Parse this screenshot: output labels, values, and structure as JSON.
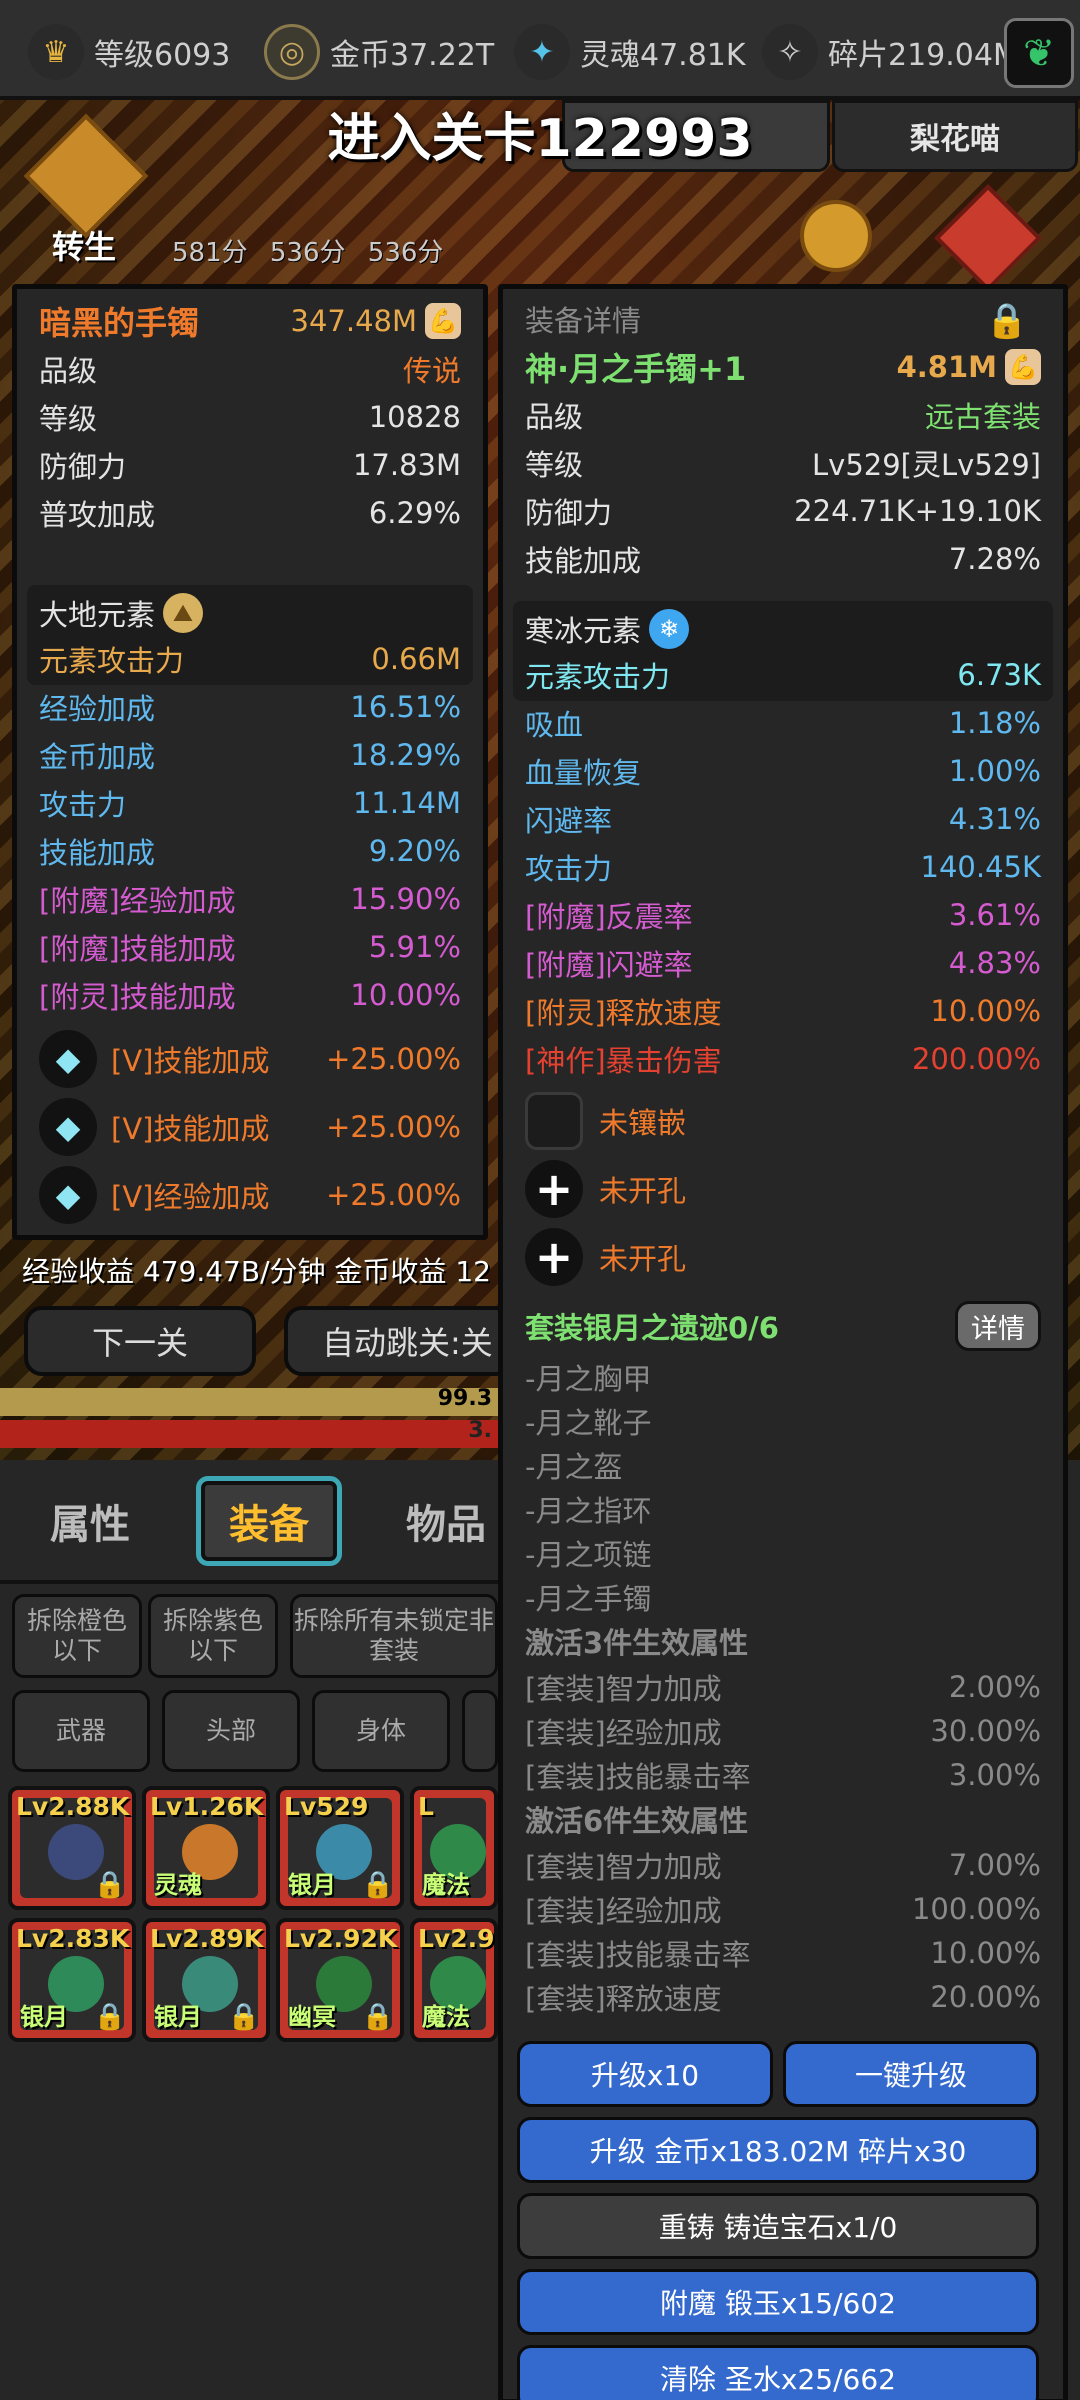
{
  "top_bar": {
    "stats": [
      {
        "icon": "crown-icon",
        "label": "等级6093"
      },
      {
        "icon": "coin-icon",
        "label": "金币37.22T"
      },
      {
        "icon": "soul-icon",
        "label": "灵魂47.81K"
      },
      {
        "icon": "shard-icon",
        "label": "碎片219.04M"
      }
    ]
  },
  "banner": "进入关卡122993",
  "top_tab_right": "梨花喵",
  "rebirth_label": "转生",
  "scores": "581分 536分 536分",
  "left_item": {
    "name": "暗黑的手镯",
    "power": "347.48M",
    "rows": [
      {
        "k": "品级",
        "v": "传说"
      },
      {
        "k": "等级",
        "v": "10828"
      },
      {
        "k": "防御力",
        "v": "17.83M"
      },
      {
        "k": "普攻加成",
        "v": "6.29%"
      }
    ],
    "element_name": "大地元素",
    "element_attack": {
      "k": "元素攻击力",
      "v": "0.66M"
    },
    "blue_rows": [
      {
        "k": "经验加成",
        "v": "16.51%"
      },
      {
        "k": "金币加成",
        "v": "18.29%"
      },
      {
        "k": "攻击力",
        "v": "11.14M"
      },
      {
        "k": "技能加成",
        "v": "9.20%"
      }
    ],
    "pink_rows": [
      {
        "k": "[附魔]经验加成",
        "v": "15.90%"
      },
      {
        "k": "[附魔]技能加成",
        "v": "5.91%"
      },
      {
        "k": "[附灵]技能加成",
        "v": "10.00%"
      }
    ],
    "gems": [
      {
        "k": "[V]技能加成",
        "v": "+25.00%"
      },
      {
        "k": "[V]技能加成",
        "v": "+25.00%"
      },
      {
        "k": "[V]经验加成",
        "v": "+25.00%"
      }
    ]
  },
  "right_item": {
    "header": "装备详情",
    "name": "神·月之手镯+1",
    "power": "4.81M",
    "rows": [
      {
        "k": "品级",
        "v": "远古套装"
      },
      {
        "k": "等级",
        "v": "Lv529[灵Lv529]"
      },
      {
        "k": "防御力",
        "v": "224.71K+19.10K"
      },
      {
        "k": "技能加成",
        "v": "7.28%"
      }
    ],
    "element_name": "寒冰元素",
    "element_attack": {
      "k": "元素攻击力",
      "v": "6.73K"
    },
    "blue_rows": [
      {
        "k": "吸血",
        "v": "1.18%"
      },
      {
        "k": "血量恢复",
        "v": "1.00%"
      },
      {
        "k": "闪避率",
        "v": "4.31%"
      },
      {
        "k": "攻击力",
        "v": "140.45K"
      }
    ],
    "pink_rows": [
      {
        "k": "[附魔]反震率",
        "v": "3.61%"
      },
      {
        "k": "[附魔]闪避率",
        "v": "4.83%"
      }
    ],
    "orange_row": {
      "k": "[附灵]释放速度",
      "v": "10.00%"
    },
    "red_row": {
      "k": "[神作]暴击伤害",
      "v": "200.00%"
    },
    "sockets": [
      "未镶嵌",
      "未开孔",
      "未开孔"
    ],
    "set_title": "套装银月之遗迹0/6",
    "set_detail_label": "详情",
    "set_pieces": [
      "-月之胸甲",
      "-月之靴子",
      "-月之盔",
      "-月之指环",
      "-月之项链",
      "-月之手镯"
    ],
    "set3_title": "激活3件生效属性",
    "set3_rows": [
      {
        "k": "[套装]智力加成",
        "v": "2.00%"
      },
      {
        "k": "[套装]经验加成",
        "v": "30.00%"
      },
      {
        "k": "[套装]技能暴击率",
        "v": "3.00%"
      }
    ],
    "set6_title": "激活6件生效属性",
    "set6_rows": [
      {
        "k": "[套装]智力加成",
        "v": "7.00%"
      },
      {
        "k": "[套装]经验加成",
        "v": "100.00%"
      },
      {
        "k": "[套装]技能暴击率",
        "v": "10.00%"
      },
      {
        "k": "[套装]释放速度",
        "v": "20.00%"
      }
    ],
    "buttons": {
      "upgrade10": "升级x10",
      "oneclick": "一键升级",
      "upgrade": "升级 金币x183.02M 碎片x30",
      "recast": "重铸 铸造宝石x1/0",
      "enchant": "附魔 锻玉x15/602",
      "clear": "清除 圣水x25/662"
    }
  },
  "income": "经验收益 479.47B/分钟 金币收益 12",
  "nav": {
    "next": "下一关",
    "auto": "自动跳关:关"
  },
  "bars": {
    "exp_text": "99.3",
    "hp_text": "3."
  },
  "tabs": [
    "属性",
    "装备",
    "物品"
  ],
  "filters": {
    "remove_orange": "拆除橙色以下",
    "remove_purple": "拆除紫色以下",
    "remove_unlocked": "拆除所有未锁定非套装"
  },
  "slots": [
    "武器",
    "头部",
    "身体"
  ],
  "grid": [
    {
      "lv": "Lv2.88K",
      "name": ""
    },
    {
      "lv": "Lv1.26K",
      "name": "灵魂"
    },
    {
      "lv": "Lv529",
      "name": "银月"
    },
    {
      "lv": "L",
      "name": "魔法"
    },
    {
      "lv": "Lv2.83K",
      "name": "银月"
    },
    {
      "lv": "Lv2.89K",
      "name": "银月"
    },
    {
      "lv": "Lv2.92K",
      "name": "幽冥"
    },
    {
      "lv": "Lv2.9",
      "name": "魔法"
    }
  ]
}
